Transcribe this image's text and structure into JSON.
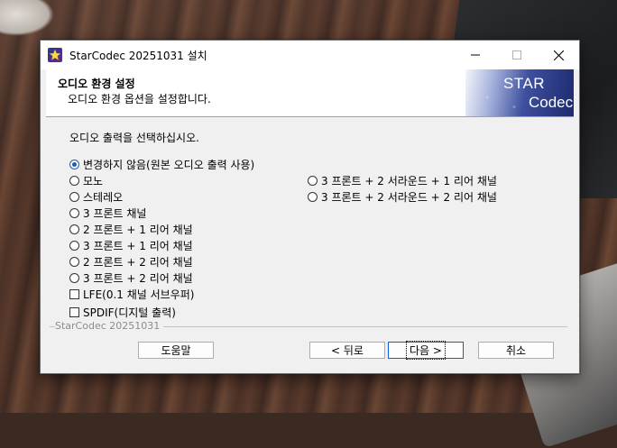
{
  "window": {
    "title": "StarCodec 20251031 설치",
    "min_icon": "—",
    "max_icon": "☐",
    "close_icon": "✕"
  },
  "header": {
    "title": "오디오 환경 설정",
    "subtitle": "오디오 환경 옵션을 설정합니다.",
    "banner_line1": "STAR",
    "banner_line2": "Codec"
  },
  "main": {
    "prompt": "오디오 출력을 선택하십시오.",
    "left_options": [
      {
        "label": "변경하지 않음(원본 오디오 출력 사용)",
        "selected": true
      },
      {
        "label": "모노",
        "selected": false
      },
      {
        "label": "스테레오",
        "selected": false
      },
      {
        "label": "3 프론트 채널",
        "selected": false
      },
      {
        "label": "2 프론트 + 1 리어 채널",
        "selected": false
      },
      {
        "label": "3 프론트 + 1 리어 채널",
        "selected": false
      },
      {
        "label": "2 프론트 + 2 리어 채널",
        "selected": false
      },
      {
        "label": "3 프론트 + 2 리어 채널",
        "selected": false
      }
    ],
    "right_options": [
      {
        "label": "3 프론트 + 2 서라운드 + 1 리어 채널",
        "selected": false
      },
      {
        "label": "3 프론트 + 2 서라운드 + 2 리어 채널",
        "selected": false
      }
    ],
    "checkboxes": [
      {
        "label": "LFE(0.1 채널 서브우퍼)",
        "checked": false
      },
      {
        "label": "SPDIF(디지털 출력)",
        "checked": false
      }
    ]
  },
  "footer": {
    "brand": "StarCodec 20251031",
    "help_label": "도움말",
    "back_label": "< 뒤로",
    "next_label": "다음 >",
    "cancel_label": "취소"
  },
  "colors": {
    "accent": "#1a5fb4",
    "banner_dark": "#1c2a6e"
  }
}
